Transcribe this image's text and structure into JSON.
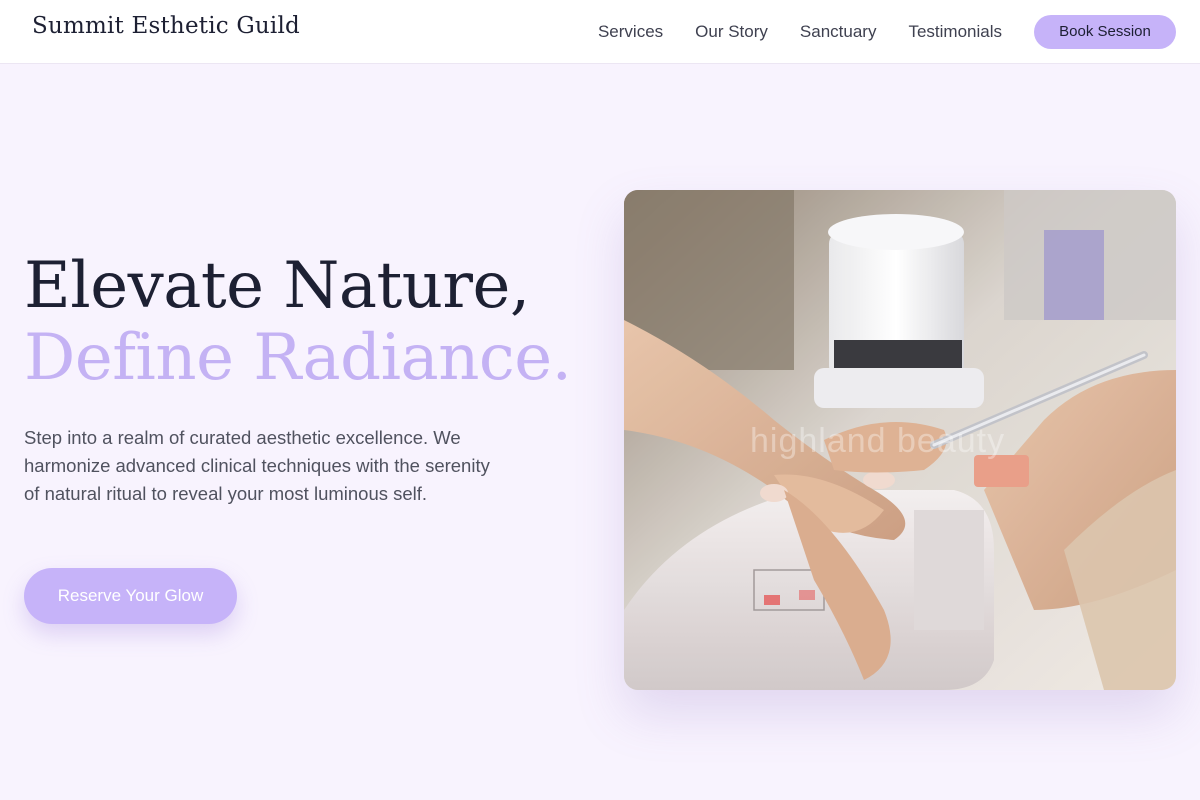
{
  "brand": {
    "name": "Summit Esthetic Guild"
  },
  "nav": {
    "links": [
      "Services",
      "Our Story",
      "Sanctuary",
      "Testimonials"
    ],
    "book_label": "Book Session"
  },
  "hero": {
    "title_line_1": "Elevate Nature,",
    "title_line_2": "Define Radiance.",
    "description": "Step into a realm of curated aesthetic excellence. We harmonize advanced clinical techniques with the serenity of natural ritual to reveal your most luminous self.",
    "cta_label": "Reserve Your Glow",
    "photo_watermark": "highland beauty"
  },
  "colors": {
    "accent": "#c6b3f9",
    "accent_text": "#c4b2f4",
    "heading": "#1d2033",
    "background": "#f8f3fe",
    "nav_bg": "#ffffff"
  }
}
